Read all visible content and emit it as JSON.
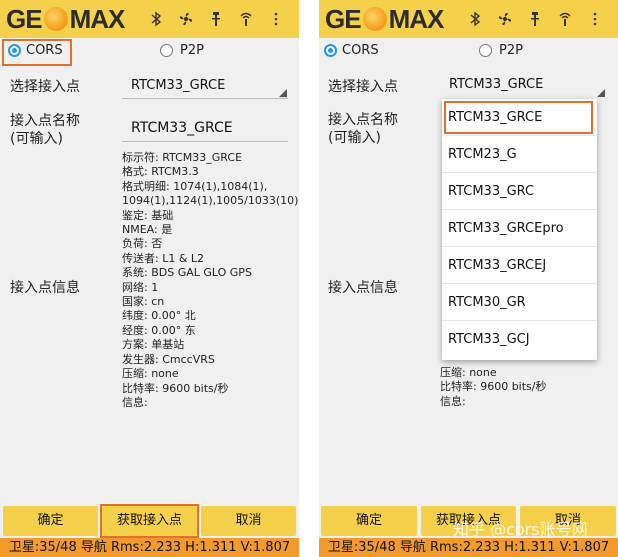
{
  "brand": {
    "left": "GE",
    "right": "MAX"
  },
  "status_icons": [
    "bluetooth-icon",
    "fan-icon",
    "antenna-icon",
    "signal-antenna-icon",
    "more-icon"
  ],
  "mode": {
    "cors": "CORS",
    "p2p": "P2P"
  },
  "select_mountpoint": {
    "label": "选择接入点",
    "value": "RTCM33_GRCE"
  },
  "mountpoint_name": {
    "label_line1": "接入点名称",
    "label_line2": "(可输入)",
    "value": "RTCM33_GRCE"
  },
  "mountpoint_info": {
    "label": "接入点信息",
    "lines": [
      "标示符: RTCM33_GRCE",
      "格式: RTCM3.3",
      "格式明细: 1074(1),1084(1),",
      "1094(1),1124(1),1005/1033(10)",
      "鉴定: 基础",
      "NMEA: 是",
      "负荷: 否",
      "传送者: L1 & L2",
      "系统: BDS GAL GLO GPS",
      "网络: 1",
      "国家: cn",
      "纬度: 0.00° 北",
      "经度: 0.00° 东",
      "方案: 单基站",
      "发生器: CmccVRS",
      "压缩: none",
      "比特率: 9600 bits/秒",
      "信息:"
    ],
    "right_visible_lines": [
      "压缩: none",
      "比特率: 9600 bits/秒",
      "信息:"
    ]
  },
  "buttons": {
    "ok": "确定",
    "get_mountpoints": "获取接入点",
    "cancel": "取消"
  },
  "status_bar": "卫星:35/48 导航 Rms:2.233 H:1.311 V:1.807",
  "dropdown_options": [
    "RTCM33_GRCE",
    "RTCM23_G",
    "RTCM33_GRC",
    "RTCM33_GRCEpro",
    "RTCM33_GRCEJ",
    "RTCM30_GR",
    "RTCM33_GCJ"
  ],
  "watermark": "知乎 @cors账号网",
  "colors": {
    "toolbar": "#f5d04a",
    "statusbar": "#f39a2c",
    "highlight": "#e0702c",
    "radio": "#2196f3"
  }
}
